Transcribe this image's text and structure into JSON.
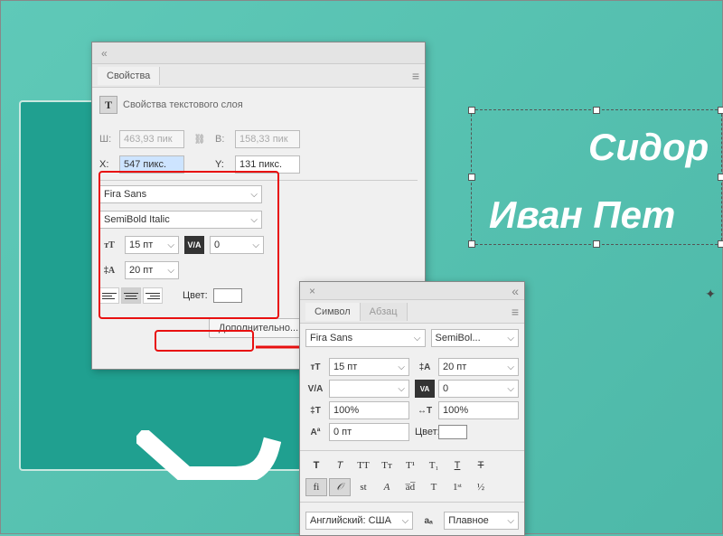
{
  "props": {
    "tab_label": "Свойства",
    "section_label": "Свойства текстового слоя",
    "w_label": "Ш:",
    "w_value": "463,93 пик",
    "h_label": "В:",
    "h_value": "158,33 пик",
    "x_label": "X:",
    "x_value": "547 пикс.",
    "y_label": "Y:",
    "y_value": "131 пикс.",
    "font_family": "Fira Sans",
    "font_style": "SemiBold Italic",
    "font_size": "15 пт",
    "kerning": "0",
    "leading": "20 пт",
    "color_label": "Цвет:",
    "advanced_btn": "Дополнительно..."
  },
  "char": {
    "tab_symbol": "Символ",
    "tab_paragraph": "Абзац",
    "font_family": "Fira Sans",
    "font_style": "SemiBol...",
    "size": "15 пт",
    "leading": "20 пт",
    "va_kern": "",
    "va_track": "0",
    "vscale": "100%",
    "hscale": "100%",
    "baseline": "0 пт",
    "color_label": "Цвет:",
    "lang": "Английский: США",
    "aa": "Плавное"
  },
  "canvas": {
    "line1": "Сидор",
    "line2": "Иван Пет"
  }
}
